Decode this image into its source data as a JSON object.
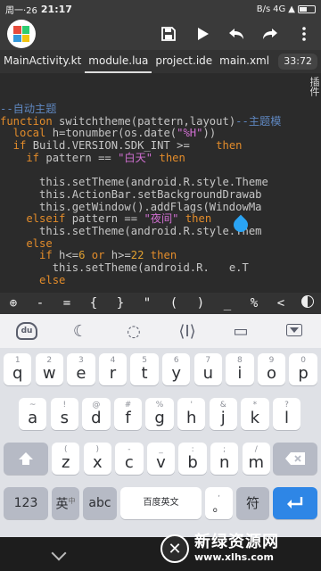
{
  "status_bar": {
    "date": "周一·26",
    "time": "21:17",
    "signal": "4G",
    "speed": "B/s",
    "battery_icon": "battery-icon"
  },
  "toolbar": {
    "logo_colors": [
      "#e74c3c",
      "#2ecc71",
      "#3498db",
      "#f1c40f"
    ],
    "icons": [
      "save-icon",
      "play-icon",
      "undo-icon",
      "redo-icon",
      "more-icon"
    ]
  },
  "tabs": {
    "items": [
      "MainActivity.kt",
      "module.lua",
      "project.ide",
      "main.xml"
    ],
    "active": "module.lua",
    "cursor_pos": "33:72"
  },
  "editor": {
    "side_label": "插件",
    "lines": [
      {
        "parts": [
          {
            "t": "--自动主题",
            "c": "cm"
          }
        ]
      },
      {
        "parts": [
          {
            "t": "function ",
            "c": "kw"
          },
          {
            "t": "switchtheme(pattern,layout)",
            "c": ""
          },
          {
            "t": "--主题模",
            "c": "cm"
          }
        ]
      },
      {
        "parts": [
          {
            "t": "  local ",
            "c": "kw"
          },
          {
            "t": "h=tonumber(os.date(",
            "c": ""
          },
          {
            "t": "\"%H\"",
            "c": "st"
          },
          {
            "t": "))",
            "c": ""
          }
        ]
      },
      {
        "parts": [
          {
            "t": "  if ",
            "c": "kw"
          },
          {
            "t": "Build.VERSION.SDK_INT >= ",
            "c": ""
          },
          {
            "t": "  ",
            "c": "num"
          },
          {
            "t": " then",
            "c": "kw"
          }
        ]
      },
      {
        "parts": [
          {
            "t": "    if ",
            "c": "kw"
          },
          {
            "t": "pattern == ",
            "c": ""
          },
          {
            "t": "\"白天\"",
            "c": "st"
          },
          {
            "t": " then",
            "c": "kw"
          }
        ]
      },
      {
        "parts": [
          {
            "t": "",
            "c": ""
          }
        ]
      },
      {
        "parts": [
          {
            "t": "      this.setTheme(android.R.style.Theme",
            "c": ""
          }
        ]
      },
      {
        "parts": [
          {
            "t": "      this.ActionBar.setBackgroundDrawab",
            "c": ""
          }
        ]
      },
      {
        "parts": [
          {
            "t": "      this.getWindow().addFlags(WindowMa",
            "c": ""
          }
        ]
      },
      {
        "parts": [
          {
            "t": "    elseif ",
            "c": "kw"
          },
          {
            "t": "pattern == ",
            "c": ""
          },
          {
            "t": "\"夜间\"",
            "c": "st"
          },
          {
            "t": " then",
            "c": "kw"
          }
        ]
      },
      {
        "parts": [
          {
            "t": "      this.setTheme(android.R.style.Them",
            "c": ""
          }
        ]
      },
      {
        "parts": [
          {
            "t": "    else",
            "c": "kw"
          }
        ]
      },
      {
        "parts": [
          {
            "t": "      if ",
            "c": "kw"
          },
          {
            "t": "h<=",
            "c": ""
          },
          {
            "t": "6",
            "c": "num"
          },
          {
            "t": " or ",
            "c": "kw"
          },
          {
            "t": "h>=",
            "c": ""
          },
          {
            "t": "22",
            "c": "num"
          },
          {
            "t": " then",
            "c": "kw"
          }
        ]
      },
      {
        "parts": [
          {
            "t": "        this.setTheme(android.R.",
            "c": ""
          },
          {
            "t": "   ",
            "c": ""
          },
          {
            "t": "e.T",
            "c": ""
          }
        ]
      },
      {
        "parts": [
          {
            "t": "      else",
            "c": "kw"
          }
        ]
      }
    ],
    "prompt": ">_"
  },
  "symbol_bar": [
    "⊕",
    "-",
    "=",
    "{",
    "}",
    "\"",
    "(",
    ")",
    "_",
    "%",
    "<"
  ],
  "ime_bar": {
    "du_label": "du",
    "icons": [
      "moon-icon",
      "search-bubble-icon",
      "cursor-icon",
      "clipboard-icon",
      "collapse-icon"
    ]
  },
  "keyboard": {
    "row1": [
      [
        "1",
        "q"
      ],
      [
        "2",
        "w"
      ],
      [
        "3",
        "e"
      ],
      [
        "4",
        "r"
      ],
      [
        "5",
        "t"
      ],
      [
        "6",
        "y"
      ],
      [
        "7",
        "u"
      ],
      [
        "8",
        "i"
      ],
      [
        "9",
        "o"
      ],
      [
        "0",
        "p"
      ]
    ],
    "row2": [
      [
        "~",
        "a"
      ],
      [
        "!",
        "s"
      ],
      [
        "@",
        "d"
      ],
      [
        "#",
        "f"
      ],
      [
        "%",
        "g"
      ],
      [
        "'",
        "h"
      ],
      [
        "&",
        "j"
      ],
      [
        "*",
        "k"
      ],
      [
        "?",
        "l"
      ]
    ],
    "row3": [
      [
        "(",
        "z"
      ],
      [
        ")",
        "x"
      ],
      [
        "-",
        "c"
      ],
      [
        "_",
        "v"
      ],
      [
        ":",
        "b"
      ],
      [
        ";",
        "n"
      ],
      [
        "/",
        "m"
      ]
    ],
    "shift_icon": "shift-icon",
    "delete_icon": "delete-icon",
    "key_123": "123",
    "key_lang": "英",
    "key_lang_sub": "中",
    "key_abc": "abc",
    "key_space": "百度英文",
    "key_punct_top": ",",
    "key_punct_bottom": "。",
    "key_fu": "符",
    "enter_icon": "enter-icon"
  },
  "watermark": {
    "title": "新绿资源网",
    "url": "www.xlhs.com"
  }
}
